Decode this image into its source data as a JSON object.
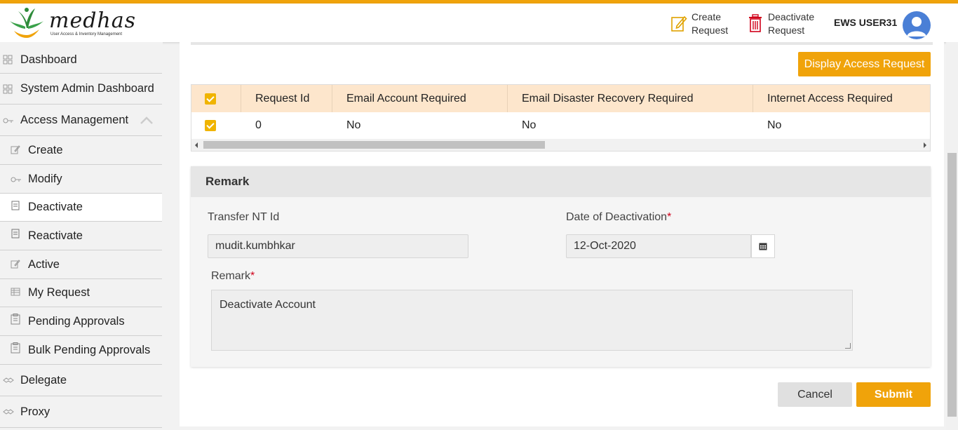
{
  "app": {
    "logo_text": "medhas",
    "logo_tagline": "User Access & Inventory Management",
    "accent_color": "#f0a30a"
  },
  "header": {
    "create_request": {
      "line1": "Create",
      "line2": "Request",
      "icon": "edit-icon"
    },
    "deactivate_request": {
      "line1": "Deactivate",
      "line2": "Request",
      "icon": "trash-icon"
    },
    "user_name": "EWS USER31",
    "avatar_icon": "user-avatar-icon"
  },
  "sidebar": {
    "items": [
      {
        "label": "Dashboard",
        "icon": "grid-icon"
      },
      {
        "label": "System Admin Dashboard",
        "icon": "grid-icon"
      },
      {
        "label": "Access Management",
        "icon": "key-icon",
        "expanded": true
      },
      {
        "label": "Create",
        "icon": "edit-icon"
      },
      {
        "label": "Modify",
        "icon": "key-icon"
      },
      {
        "label": "Deactivate",
        "icon": "document-icon",
        "active": true
      },
      {
        "label": "Reactivate",
        "icon": "document-icon"
      },
      {
        "label": "Active",
        "icon": "edit-icon"
      },
      {
        "label": "My Request",
        "icon": "table-icon"
      },
      {
        "label": "Pending Approvals",
        "icon": "clipboard-icon"
      },
      {
        "label": "Bulk Pending Approvals",
        "icon": "clipboard-icon"
      },
      {
        "label": "Delegate",
        "icon": "handshake-icon"
      },
      {
        "label": "Proxy",
        "icon": "handshake-icon"
      }
    ]
  },
  "main": {
    "display_button": "Display Access Request",
    "table": {
      "columns": [
        "Request Id",
        "Email Account Required",
        "Email Disaster Recovery Required",
        "Internet Access Required"
      ],
      "rows": [
        {
          "checked": true,
          "cells": [
            "0",
            "No",
            "No",
            "No"
          ]
        }
      ],
      "header_checked": true
    },
    "remark_section": {
      "title": "Remark",
      "transfer_label": "Transfer NT Id",
      "transfer_value": "mudit.kumbhkar",
      "date_label": "Date of Deactivation",
      "date_required": "*",
      "date_value": "12-Oct-2020",
      "remark_label": "Remark",
      "remark_required": "*",
      "remark_value": "Deactivate Account"
    },
    "cancel_button": "Cancel",
    "submit_button": "Submit"
  }
}
